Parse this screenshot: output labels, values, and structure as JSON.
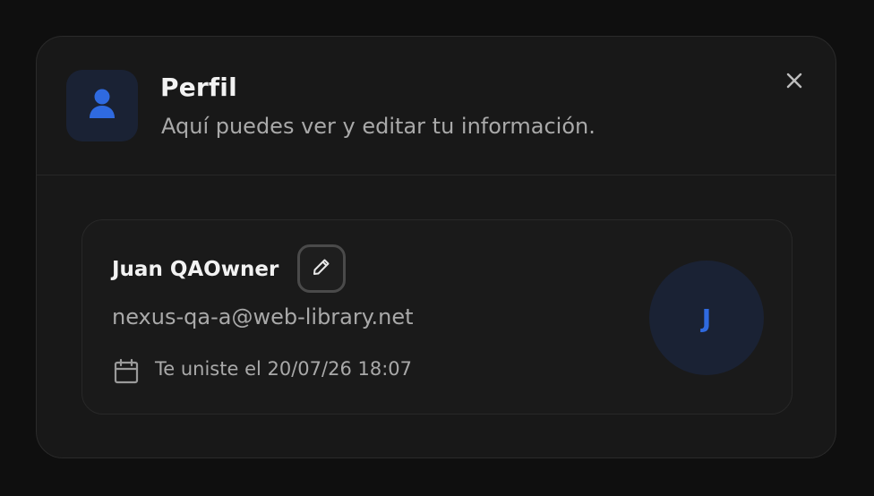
{
  "header": {
    "title": "Perfil",
    "subtitle": "Aquí puedes ver y editar tu información.",
    "icon": "user-icon",
    "close_icon": "close-icon"
  },
  "profile": {
    "name": "Juan QAOwner",
    "email": "nexus-qa-a@web-library.net",
    "joined": "Te uniste el 20/07/26 18:07",
    "avatar_initial": "J",
    "edit_icon": "pencil-icon",
    "calendar_icon": "calendar-icon"
  },
  "colors": {
    "accent": "#2f6ae0",
    "background": "#0f0f0f",
    "surface": "#181818"
  }
}
